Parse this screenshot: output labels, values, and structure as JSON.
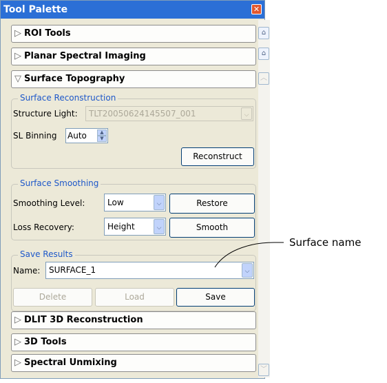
{
  "window": {
    "title": "Tool Palette"
  },
  "sections": {
    "roi": "ROI Tools",
    "planar": "Planar Spectral Imaging",
    "surface": "Surface Topography",
    "dlit": "DLIT 3D Reconstruction",
    "tools3d": "3D Tools",
    "spectral": "Spectral Unmixing"
  },
  "reconstruction": {
    "group_label": "Surface Reconstruction",
    "structure_light_label": "Structure Light:",
    "structure_light_value": "TLT20050624145507_001",
    "sl_binning_label": "SL Binning",
    "sl_binning_value": "Auto",
    "reconstruct_button": "Reconstruct"
  },
  "smoothing": {
    "group_label": "Surface Smoothing",
    "level_label": "Smoothing Level:",
    "level_value": "Low",
    "restore_button": "Restore",
    "loss_label": "Loss Recovery:",
    "loss_value": "Height",
    "smooth_button": "Smooth"
  },
  "save": {
    "group_label": "Save Results",
    "name_label": "Name:",
    "name_value": "SURFACE_1",
    "delete_button": "Delete",
    "load_button": "Load",
    "save_button": "Save"
  },
  "annotation": {
    "callout": "Surface name"
  },
  "icons": {
    "collapsed": "triangle-right",
    "expanded": "triangle-down",
    "close": "close-x"
  }
}
